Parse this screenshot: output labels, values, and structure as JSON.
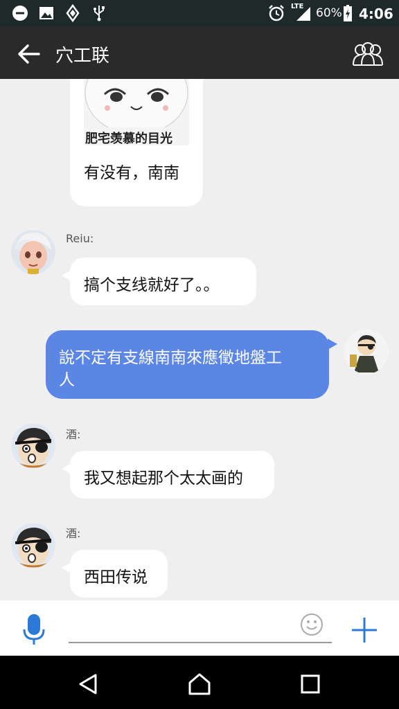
{
  "status_bar": {
    "network": "LTE",
    "battery": "60%",
    "time": "4:06"
  },
  "header": {
    "title": "穴工联"
  },
  "messages": [
    {
      "side": "left",
      "sticker_caption": "肥宅羡慕的目光",
      "text": "有没有，南南"
    },
    {
      "side": "left",
      "sender": "Reiu:",
      "text": "搞个支线就好了。。"
    },
    {
      "side": "right",
      "text_line1": "說不定有支線南南來應徵地盤工",
      "text_line2": "人"
    },
    {
      "side": "left",
      "sender": "酒:",
      "text": "我又想起那个太太画的"
    },
    {
      "side": "left",
      "sender": "酒:",
      "text": "西田传说"
    }
  ],
  "input": {
    "placeholder": ""
  },
  "colors": {
    "status_bar": "#1e2a2a",
    "app_bar": "#2a2a2a",
    "chat_bg": "#efefef",
    "outgoing_bubble": "#5b86e5",
    "accent": "#2d7ad6"
  }
}
